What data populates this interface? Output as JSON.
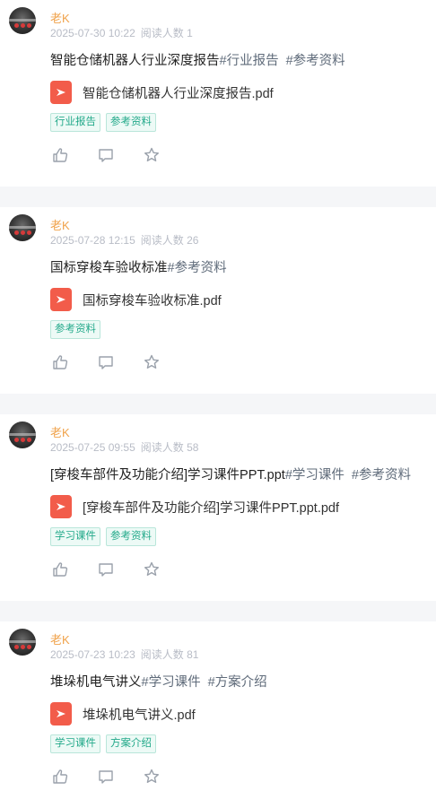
{
  "posts": [
    {
      "author": "老K",
      "time": "2025-07-30 10:22",
      "reads": "阅读人数 1",
      "title": "智能仓储机器人行业深度报告",
      "title_tags": [
        "#行业报告",
        "#参考资料"
      ],
      "file_name": "智能仓储机器人行业深度报告.pdf",
      "chips": [
        "行业报告",
        "参考资料"
      ]
    },
    {
      "author": "老K",
      "time": "2025-07-28 12:15",
      "reads": "阅读人数 26",
      "title": "国标穿梭车验收标准",
      "title_tags": [
        "#参考资料"
      ],
      "file_name": "国标穿梭车验收标准.pdf",
      "chips": [
        "参考资料"
      ]
    },
    {
      "author": "老K",
      "time": "2025-07-25 09:55",
      "reads": "阅读人数 58",
      "title": "[穿梭车部件及功能介绍]学习课件PPT.ppt",
      "title_tags": [
        "#学习课件",
        "#参考资料"
      ],
      "file_name": "[穿梭车部件及功能介绍]学习课件PPT.ppt.pdf",
      "chips": [
        "学习课件",
        "参考资料"
      ]
    },
    {
      "author": "老K",
      "time": "2025-07-23 10:23",
      "reads": "阅读人数 81",
      "title": "堆垛机电气讲义",
      "title_tags": [
        "#学习课件",
        "#方案介绍"
      ],
      "file_name": "堆垛机电气讲义.pdf",
      "chips": [
        "学习课件",
        "方案介绍"
      ]
    }
  ],
  "icons": {
    "like": "thumbs-up-icon",
    "comment": "comment-icon",
    "favorite": "star-icon",
    "file": "pdf-file-icon"
  },
  "colors": {
    "author": "#f0a24a",
    "chip_text": "#23a98a",
    "chip_bg": "#edfaf6",
    "pdf": "#f25c4a",
    "separator": "#f5f6f8"
  }
}
